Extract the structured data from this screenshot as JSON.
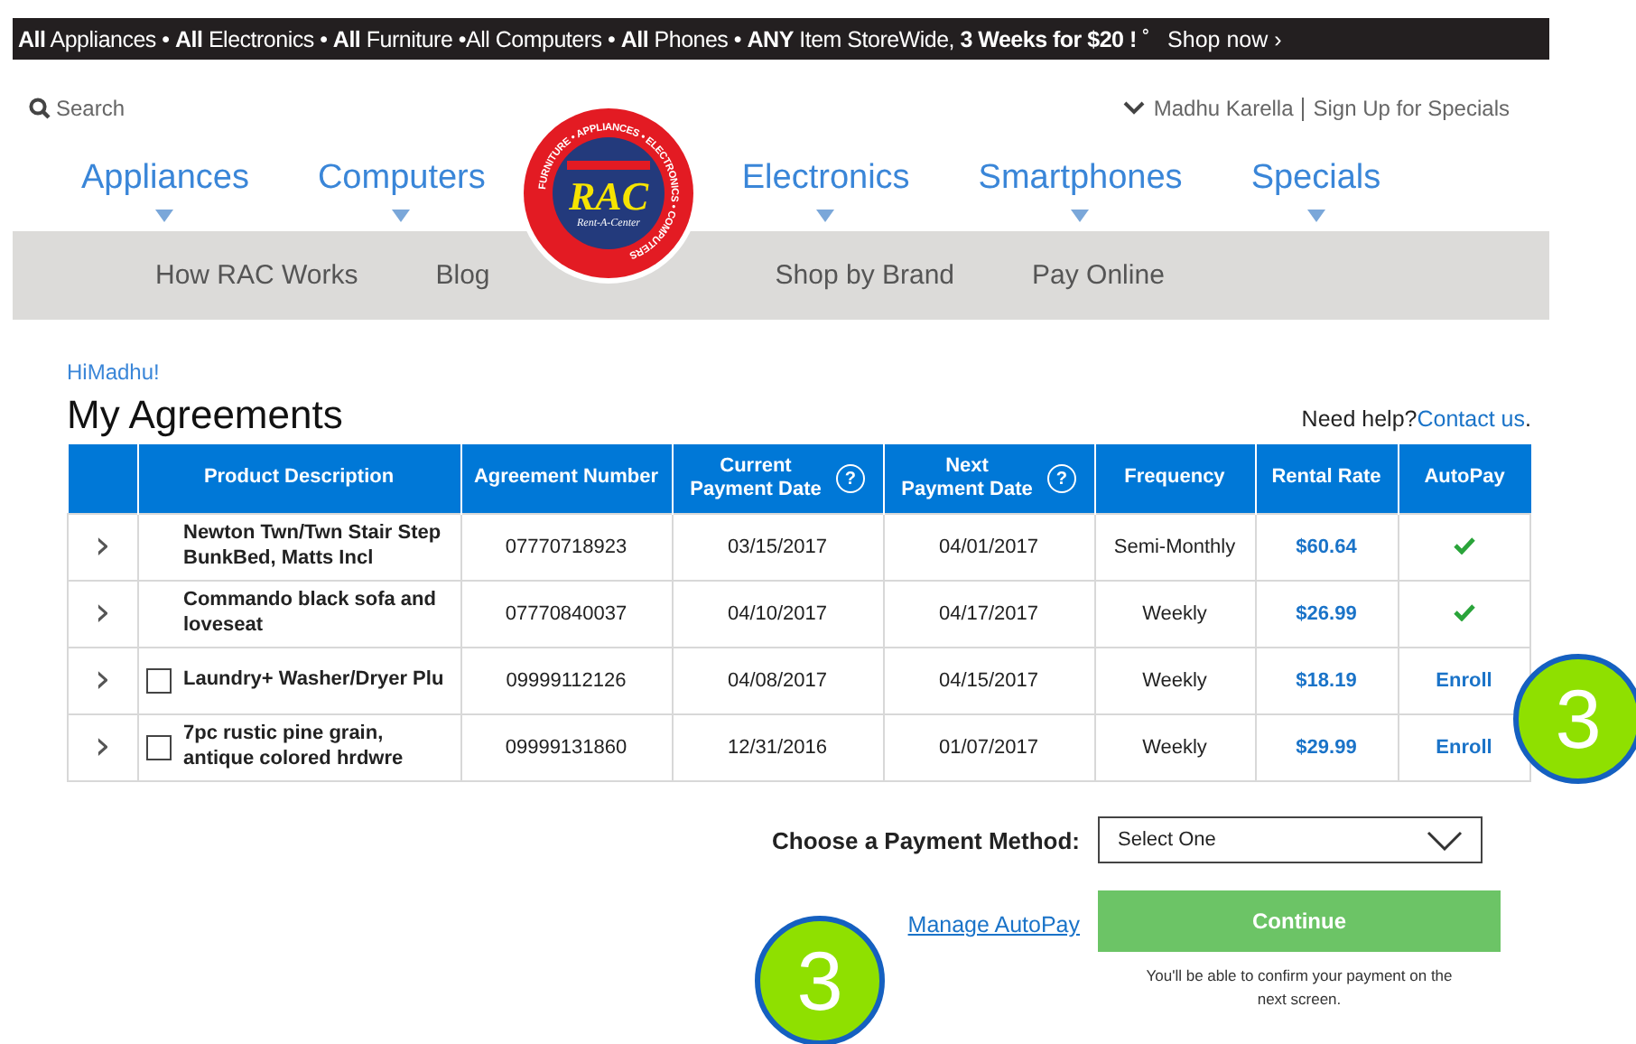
{
  "promo_bar": {
    "text": "**All** Appliances • **All** Electronics • **All** Furniture •All Computers • **All** Phones • **ANY** Item StoreWide, **3 Weeks for $20 !** ˚",
    "link": "Shop now ›"
  },
  "header": {
    "search_label": "Search",
    "user": "Madhu Karella",
    "signup": "Sign Up for Specials"
  },
  "main_nav": [
    {
      "label": "Appliances",
      "has_menu": true
    },
    {
      "label": "Computers",
      "has_menu": true
    },
    {
      "kind": "logo"
    },
    {
      "label": "Electronics",
      "has_menu": true
    },
    {
      "label": "Smartphones",
      "has_menu": true
    },
    {
      "label": "Specials",
      "has_menu": true
    }
  ],
  "logo": {
    "badge": "RAC",
    "tagline": "Rent-A-Center",
    "ring": "FURNITURE • APPLIANCES • ELECTRONICS • COMPUTERS"
  },
  "sub_nav": [
    "How RAC Works",
    "Blog",
    "Shop by Brand",
    "Pay Online"
  ],
  "greeting": "HiMadhu!",
  "title": "My Agreements",
  "help": {
    "text": "Need help?",
    "link": "Contact us",
    "after": "."
  },
  "table": {
    "columns": [
      {},
      {
        "label": "Product Description"
      },
      {
        "label": "Agreement Number"
      },
      {
        "label": "Current\nPayment Date",
        "help": "?"
      },
      {
        "label": "Next\nPayment Date",
        "help": "?"
      },
      {
        "label": "Frequency"
      },
      {
        "label": "Rental Rate"
      },
      {
        "label": "AutoPay"
      }
    ],
    "rows": [
      {
        "expand": "›",
        "description": "Newton Twn/Twn Stair Step BunkBed, Matts Incl",
        "agreement": "07770718923",
        "current_date": "03/15/2017",
        "next_date": "04/01/2017",
        "frequency": "Semi-Monthly",
        "rate": "$60.64",
        "autopay": {
          "kind": "check"
        }
      },
      {
        "expand": "›",
        "description": "Commando black sofa and loveseat",
        "agreement": "07770840037",
        "current_date": "04/10/2017",
        "next_date": "04/17/2017",
        "frequency": "Weekly",
        "rate": "$26.99",
        "autopay": {
          "kind": "check"
        }
      },
      {
        "expand": "›",
        "checked": false,
        "description": "Laundry+ Washer/Dryer Plu",
        "agreement": "09999112126",
        "current_date": "04/08/2017",
        "next_date": "04/15/2017",
        "frequency": "Weekly",
        "rate": "$18.19",
        "autopay": {
          "kind": "link",
          "label": "Enroll"
        }
      },
      {
        "expand": "›",
        "checked": false,
        "description": "7pc rustic pine grain, antique colored hrdwre",
        "agreement": "09999131860",
        "current_date": "12/31/2016",
        "next_date": "01/07/2017",
        "frequency": "Weekly",
        "rate": "$29.99",
        "autopay": {
          "kind": "link",
          "label": "Enroll"
        }
      }
    ]
  },
  "payment": {
    "label": "Choose a Payment Method:",
    "select_value": "Select One",
    "manage_link": "Manage AutoPay",
    "continue": "Continue",
    "note": "You'll be able to confirm your payment on the next screen."
  },
  "callouts": [
    {
      "text": "3"
    },
    {
      "text": "3"
    }
  ]
}
